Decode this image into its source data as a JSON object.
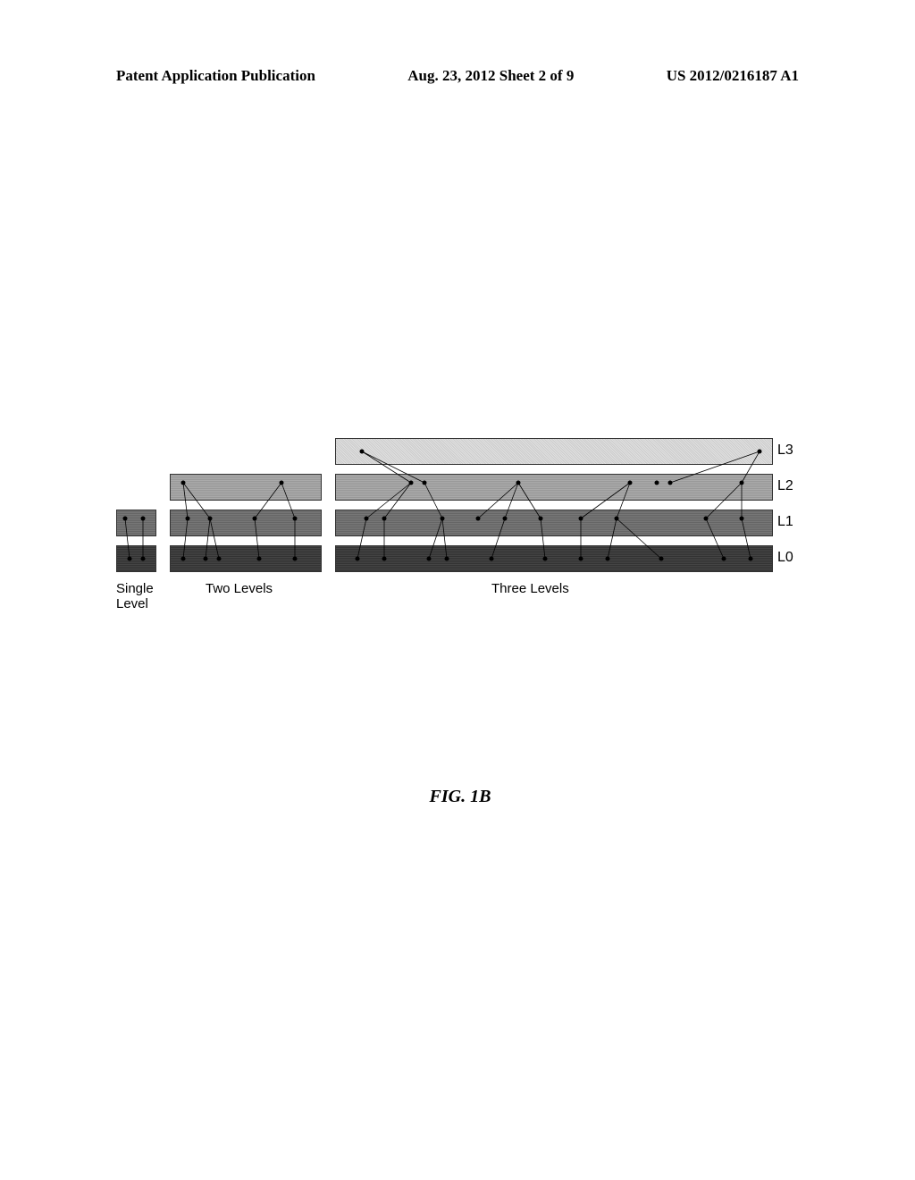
{
  "header": {
    "left": "Patent Application Publication",
    "center": "Aug. 23, 2012  Sheet 2 of 9",
    "right": "US 2012/0216187 A1"
  },
  "figure": {
    "caption": "FIG. 1B",
    "levels": {
      "l3": "L3",
      "l2": "L2",
      "l1": "L1",
      "l0": "L0"
    },
    "groups": {
      "single": "Single\nLevel",
      "two": "Two Levels",
      "three": "Three Levels"
    }
  }
}
